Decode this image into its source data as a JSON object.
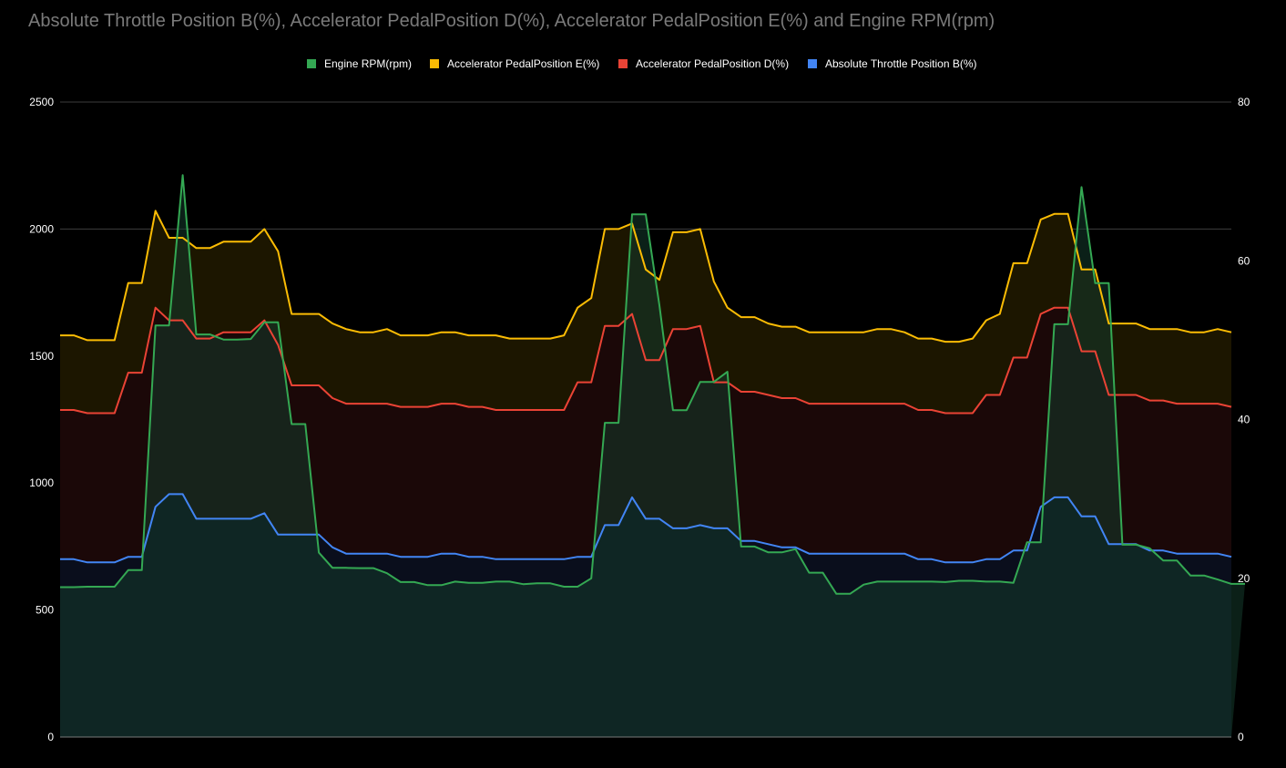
{
  "chart_data": {
    "type": "area",
    "title": "Absolute Throttle Position B(%), Accelerator PedalPosition D(%), Accelerator PedalPosition E(%) and Engine RPM(rpm)",
    "legend_position": "top",
    "grid": true,
    "left_axis": {
      "ylim": [
        0,
        2500
      ],
      "ticks": [
        "0",
        "500",
        "1000",
        "1500",
        "2000",
        "2500"
      ]
    },
    "right_axis": {
      "ylim": [
        0,
        80
      ],
      "ticks": [
        "0",
        "20",
        "40",
        "60",
        "80"
      ]
    },
    "x_count": 87,
    "series": [
      {
        "name": "Engine RPM(rpm)",
        "axis": "left",
        "color": "#34a853",
        "fill": "#143b2b",
        "values": [
          590,
          590,
          592,
          592,
          592,
          657,
          657,
          1620,
          1620,
          2212,
          1585,
          1585,
          1565,
          1565,
          1567,
          1633,
          1633,
          1232,
          1232,
          726,
          666,
          666,
          665,
          665,
          645,
          610,
          610,
          598,
          598,
          612,
          607,
          607,
          612,
          612,
          602,
          605,
          605,
          592,
          592,
          625,
          1237,
          1237,
          2058,
          2058,
          1700,
          1287,
          1287,
          1398,
          1398,
          1438,
          750,
          750,
          727,
          727,
          740,
          647,
          647,
          564,
          564,
          600,
          612,
          612,
          612,
          612,
          612,
          610,
          615,
          615,
          612,
          612,
          607,
          767,
          767,
          1625,
          1625,
          2165,
          1787,
          1787,
          757,
          757,
          743,
          695,
          695,
          636,
          636,
          620,
          603,
          603
        ]
      },
      {
        "name": "Accelerator PedalPosition E(%)",
        "axis": "right",
        "color": "#fbbc04",
        "fill": "#1c1600",
        "values": [
          50.6,
          50.6,
          50.0,
          50.0,
          50.0,
          57.2,
          57.2,
          66.3,
          62.9,
          62.9,
          61.6,
          61.6,
          62.4,
          62.4,
          62.4,
          64.0,
          61.2,
          53.3,
          53.3,
          53.3,
          52.1,
          51.4,
          51.0,
          51.0,
          51.4,
          50.6,
          50.6,
          50.6,
          51.0,
          51.0,
          50.6,
          50.6,
          50.6,
          50.2,
          50.2,
          50.2,
          50.2,
          50.6,
          54.1,
          55.3,
          64.0,
          64.0,
          64.7,
          58.9,
          57.6,
          63.6,
          63.6,
          64.0,
          57.4,
          54.1,
          52.9,
          52.9,
          52.1,
          51.7,
          51.7,
          51.0,
          51.0,
          51.0,
          51.0,
          51.0,
          51.4,
          51.4,
          51.0,
          50.2,
          50.2,
          49.8,
          49.8,
          50.2,
          52.5,
          53.3,
          59.7,
          59.7,
          65.2,
          65.9,
          65.9,
          58.9,
          58.9,
          52.1,
          52.1,
          52.1,
          51.4,
          51.4,
          51.4,
          51.0,
          51.0,
          51.4,
          51.0
        ]
      },
      {
        "name": "Accelerator PedalPosition D(%)",
        "axis": "right",
        "color": "#ea4335",
        "fill": "#1b0808",
        "values": [
          41.2,
          41.2,
          40.8,
          40.8,
          40.8,
          45.9,
          45.9,
          54.1,
          52.5,
          52.5,
          50.2,
          50.2,
          51.0,
          51.0,
          51.0,
          52.5,
          49.4,
          44.3,
          44.3,
          44.3,
          42.7,
          42.0,
          42.0,
          42.0,
          42.0,
          41.6,
          41.6,
          41.6,
          42.0,
          42.0,
          41.6,
          41.6,
          41.2,
          41.2,
          41.2,
          41.2,
          41.2,
          41.2,
          44.7,
          44.7,
          51.8,
          51.8,
          53.3,
          47.5,
          47.5,
          51.4,
          51.4,
          51.8,
          44.7,
          44.7,
          43.5,
          43.5,
          43.1,
          42.7,
          42.7,
          42.0,
          42.0,
          42.0,
          42.0,
          42.0,
          42.0,
          42.0,
          42.0,
          41.2,
          41.2,
          40.8,
          40.8,
          40.8,
          43.1,
          43.1,
          47.8,
          47.8,
          53.3,
          54.1,
          54.1,
          48.6,
          48.6,
          43.1,
          43.1,
          43.1,
          42.4,
          42.4,
          42.0,
          42.0,
          42.0,
          42.0,
          41.6
        ]
      },
      {
        "name": "Absolute Throttle Position B(%)",
        "axis": "right",
        "color": "#4285f4",
        "fill": "#0a0e1c",
        "values": [
          22.4,
          22.4,
          22.0,
          22.0,
          22.0,
          22.7,
          22.7,
          29.0,
          30.6,
          30.6,
          27.5,
          27.5,
          27.5,
          27.5,
          27.5,
          28.2,
          25.5,
          25.5,
          25.5,
          25.5,
          23.9,
          23.1,
          23.1,
          23.1,
          23.1,
          22.7,
          22.7,
          22.7,
          23.1,
          23.1,
          22.7,
          22.7,
          22.4,
          22.4,
          22.4,
          22.4,
          22.4,
          22.4,
          22.7,
          22.7,
          26.7,
          26.7,
          30.2,
          27.5,
          27.5,
          26.3,
          26.3,
          26.7,
          26.3,
          26.3,
          24.7,
          24.7,
          24.3,
          23.9,
          23.9,
          23.1,
          23.1,
          23.1,
          23.1,
          23.1,
          23.1,
          23.1,
          23.1,
          22.4,
          22.4,
          22.0,
          22.0,
          22.0,
          22.4,
          22.4,
          23.5,
          23.5,
          29.0,
          30.2,
          30.2,
          27.8,
          27.8,
          24.3,
          24.3,
          24.3,
          23.5,
          23.5,
          23.1,
          23.1,
          23.1,
          23.1,
          22.7
        ]
      }
    ],
    "legend_order": [
      0,
      1,
      2,
      3
    ]
  }
}
